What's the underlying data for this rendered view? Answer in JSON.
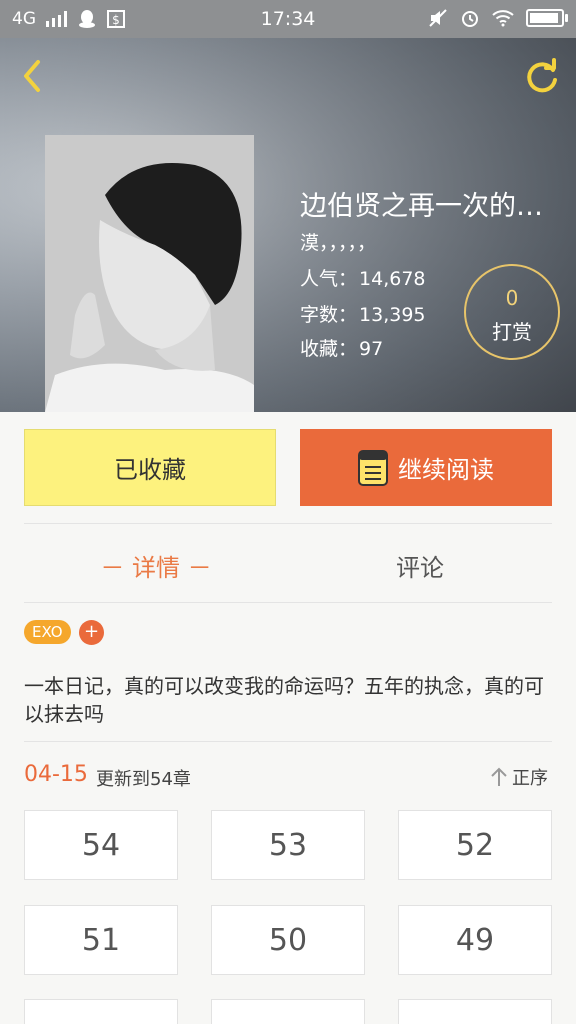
{
  "status_bar": {
    "network": "4G",
    "time": "17:34"
  },
  "book": {
    "title": "边伯贤之再一次的…",
    "author": "漠，，，，，",
    "popularity_label": "人气：",
    "popularity_value": "14,678",
    "words_label": "字数：",
    "words_value": "13,395",
    "favorites_label": "收藏：",
    "favorites_value": "97"
  },
  "tip": {
    "count": "0",
    "label": "打赏"
  },
  "actions": {
    "favorited_label": "已收藏",
    "continue_label": "继续阅读"
  },
  "tabs": {
    "detail": "－ 详情 －",
    "comment": "评论"
  },
  "tags": {
    "tag1": "EXO",
    "add": "+"
  },
  "description": "一本日记，真的可以改变我的命运吗？五年的执念，真的可以抹去吗",
  "update": {
    "date": "04-15",
    "text": "更新到54章",
    "order_label": "正序"
  },
  "chapters": [
    "54",
    "53",
    "52",
    "51",
    "50",
    "49",
    "",
    "",
    ""
  ],
  "colors": {
    "accent_orange": "#ea6a3b",
    "fav_yellow": "#fdf27e",
    "tag_orange": "#f5a72c",
    "tip_gold": "#e7c46a"
  }
}
